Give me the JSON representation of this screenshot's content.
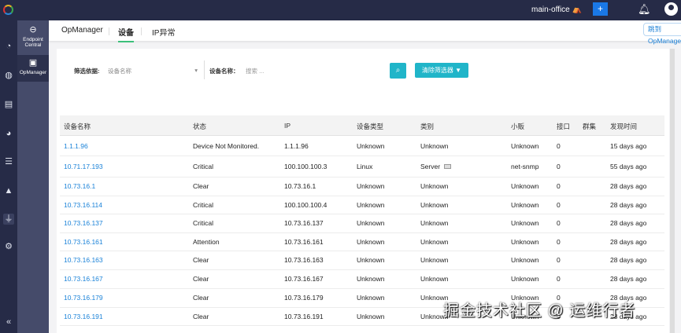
{
  "header": {
    "office": "main-office",
    "add_label": "+"
  },
  "sidebar": {
    "items": [
      {
        "label": "Endpoint Central"
      },
      {
        "label": "OpManager"
      }
    ]
  },
  "tabs": [
    {
      "label": "OpManager"
    },
    {
      "label": "设备"
    },
    {
      "label": "IP异常"
    }
  ],
  "jump_label": "跳到 OpManager",
  "filter": {
    "by_label": "筛选依据:",
    "by_value": "设备名称",
    "name_label": "设备名称：",
    "search_placeholder": "搜索 ...",
    "clear_label": "清除筛选器"
  },
  "table": {
    "headers": [
      "设备名称",
      "状态",
      "IP",
      "设备类型",
      "类别",
      "小贩",
      "接口",
      "群集",
      "发现时间"
    ],
    "rows": [
      [
        "1.1.1.96",
        "Device Not Monitored.",
        "1.1.1.96",
        "Unknown",
        "Unknown",
        "Unknown",
        "0",
        "",
        "15 days ago"
      ],
      [
        "10.71.17.193",
        "Critical",
        "100.100.100.3",
        "Linux",
        "Server",
        "net-snmp",
        "0",
        "",
        "55 days ago"
      ],
      [
        "10.73.16.1",
        "Clear",
        "10.73.16.1",
        "Unknown",
        "Unknown",
        "Unknown",
        "0",
        "",
        "28 days ago"
      ],
      [
        "10.73.16.114",
        "Critical",
        "100.100.100.4",
        "Unknown",
        "Unknown",
        "Unknown",
        "0",
        "",
        "28 days ago"
      ],
      [
        "10.73.16.137",
        "Critical",
        "10.73.16.137",
        "Unknown",
        "Unknown",
        "Unknown",
        "0",
        "",
        "28 days ago"
      ],
      [
        "10.73.16.161",
        "Attention",
        "10.73.16.161",
        "Unknown",
        "Unknown",
        "Unknown",
        "0",
        "",
        "28 days ago"
      ],
      [
        "10.73.16.163",
        "Clear",
        "10.73.16.163",
        "Unknown",
        "Unknown",
        "Unknown",
        "0",
        "",
        "28 days ago"
      ],
      [
        "10.73.16.167",
        "Clear",
        "10.73.16.167",
        "Unknown",
        "Unknown",
        "Unknown",
        "0",
        "",
        "28 days ago"
      ],
      [
        "10.73.16.179",
        "Clear",
        "10.73.16.179",
        "Unknown",
        "Unknown",
        "Unknown",
        "0",
        "",
        "28 days ago"
      ],
      [
        "10.73.16.191",
        "Clear",
        "10.73.16.191",
        "Unknown",
        "Unknown",
        "Unknown",
        "0",
        "",
        "28 days ago"
      ]
    ]
  },
  "watermark": "掘金技术社区 @ 运维行者",
  "colors": {
    "topbar": "#262b47",
    "accent": "#20b5c9",
    "link": "#1a82d8",
    "active_tab": "#3cbf7a"
  }
}
